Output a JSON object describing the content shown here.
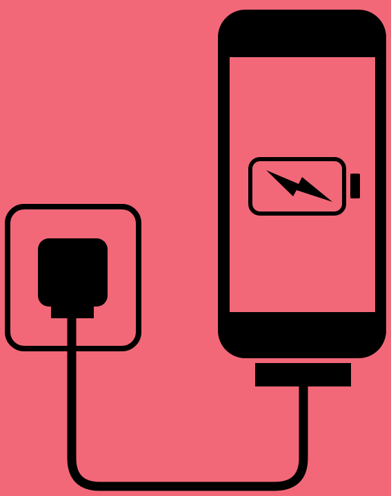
{
  "colors": {
    "background": "#F26878",
    "ink": "#000000",
    "screen": "#F26878"
  },
  "icons": {
    "outlet": "wall-outlet-icon",
    "plug": "plug-icon",
    "cable": "charging-cable-icon",
    "phone": "smartphone-icon",
    "battery": "battery-icon",
    "bolt": "lightning-bolt-icon"
  }
}
